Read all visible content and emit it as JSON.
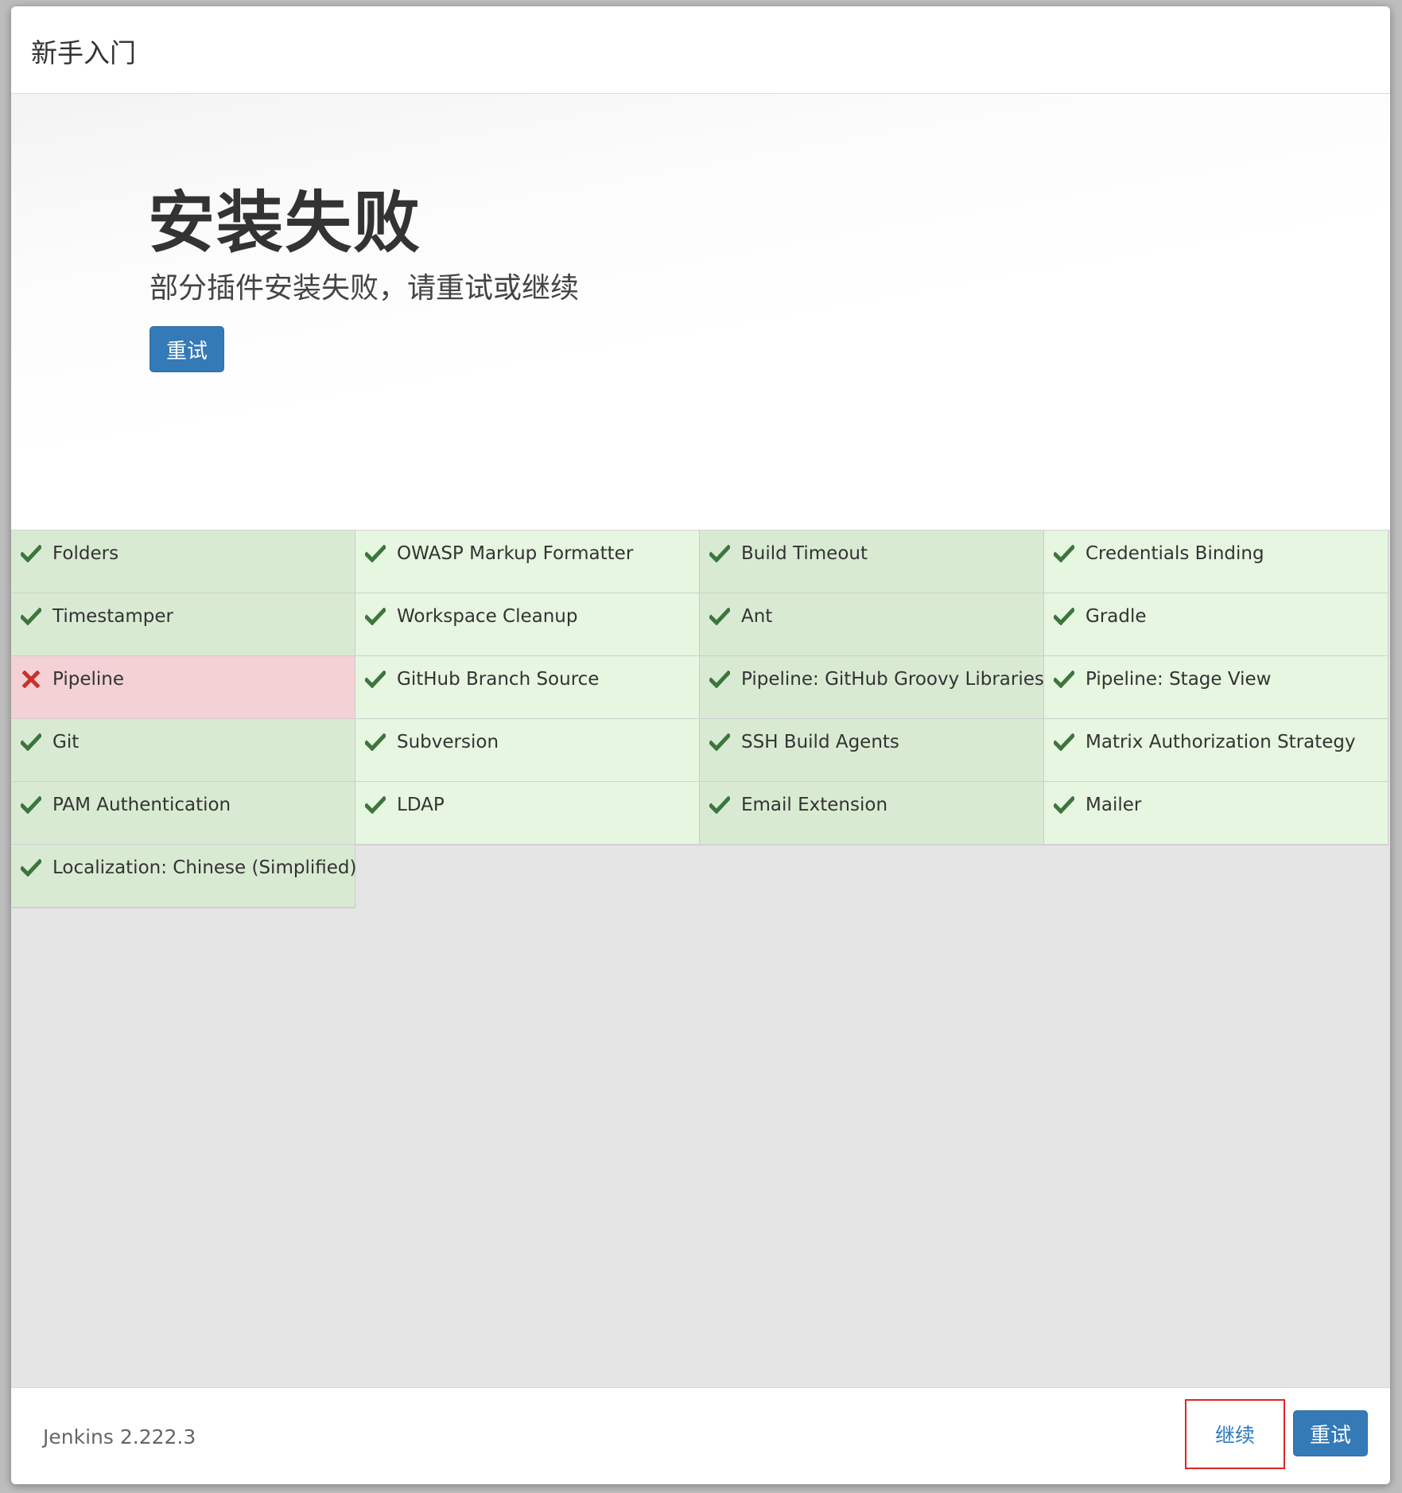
{
  "header": {
    "title": "新手入门"
  },
  "hero": {
    "title": "安装失败",
    "subtitle": "部分插件安装失败，请重试或继续",
    "retry_label": "重试"
  },
  "plugins": [
    {
      "label": "Folders",
      "status": "success"
    },
    {
      "label": "OWASP Markup Formatter",
      "status": "success"
    },
    {
      "label": "Build Timeout",
      "status": "success"
    },
    {
      "label": "Credentials Binding",
      "status": "success"
    },
    {
      "label": "Timestamper",
      "status": "success"
    },
    {
      "label": "Workspace Cleanup",
      "status": "success"
    },
    {
      "label": "Ant",
      "status": "success"
    },
    {
      "label": "Gradle",
      "status": "success"
    },
    {
      "label": "Pipeline",
      "status": "failed"
    },
    {
      "label": "GitHub Branch Source",
      "status": "success"
    },
    {
      "label": "Pipeline: GitHub Groovy Libraries",
      "status": "success"
    },
    {
      "label": "Pipeline: Stage View",
      "status": "success"
    },
    {
      "label": "Git",
      "status": "success"
    },
    {
      "label": "Subversion",
      "status": "success"
    },
    {
      "label": "SSH Build Agents",
      "status": "success"
    },
    {
      "label": "Matrix Authorization Strategy",
      "status": "success"
    },
    {
      "label": "PAM Authentication",
      "status": "success"
    },
    {
      "label": "LDAP",
      "status": "success"
    },
    {
      "label": "Email Extension",
      "status": "success"
    },
    {
      "label": "Mailer",
      "status": "success"
    },
    {
      "label": "Localization: Chinese (Simplified)",
      "status": "success"
    }
  ],
  "footer": {
    "version": "Jenkins 2.222.3",
    "continue_label": "继续",
    "retry_label": "重试"
  },
  "colors": {
    "primary": "#337ab7",
    "success_icon": "#3c763d",
    "fail_icon": "#c9302c",
    "highlight_border": "#e02424"
  },
  "icons": {
    "success": "check-icon",
    "failed": "cross-icon"
  }
}
